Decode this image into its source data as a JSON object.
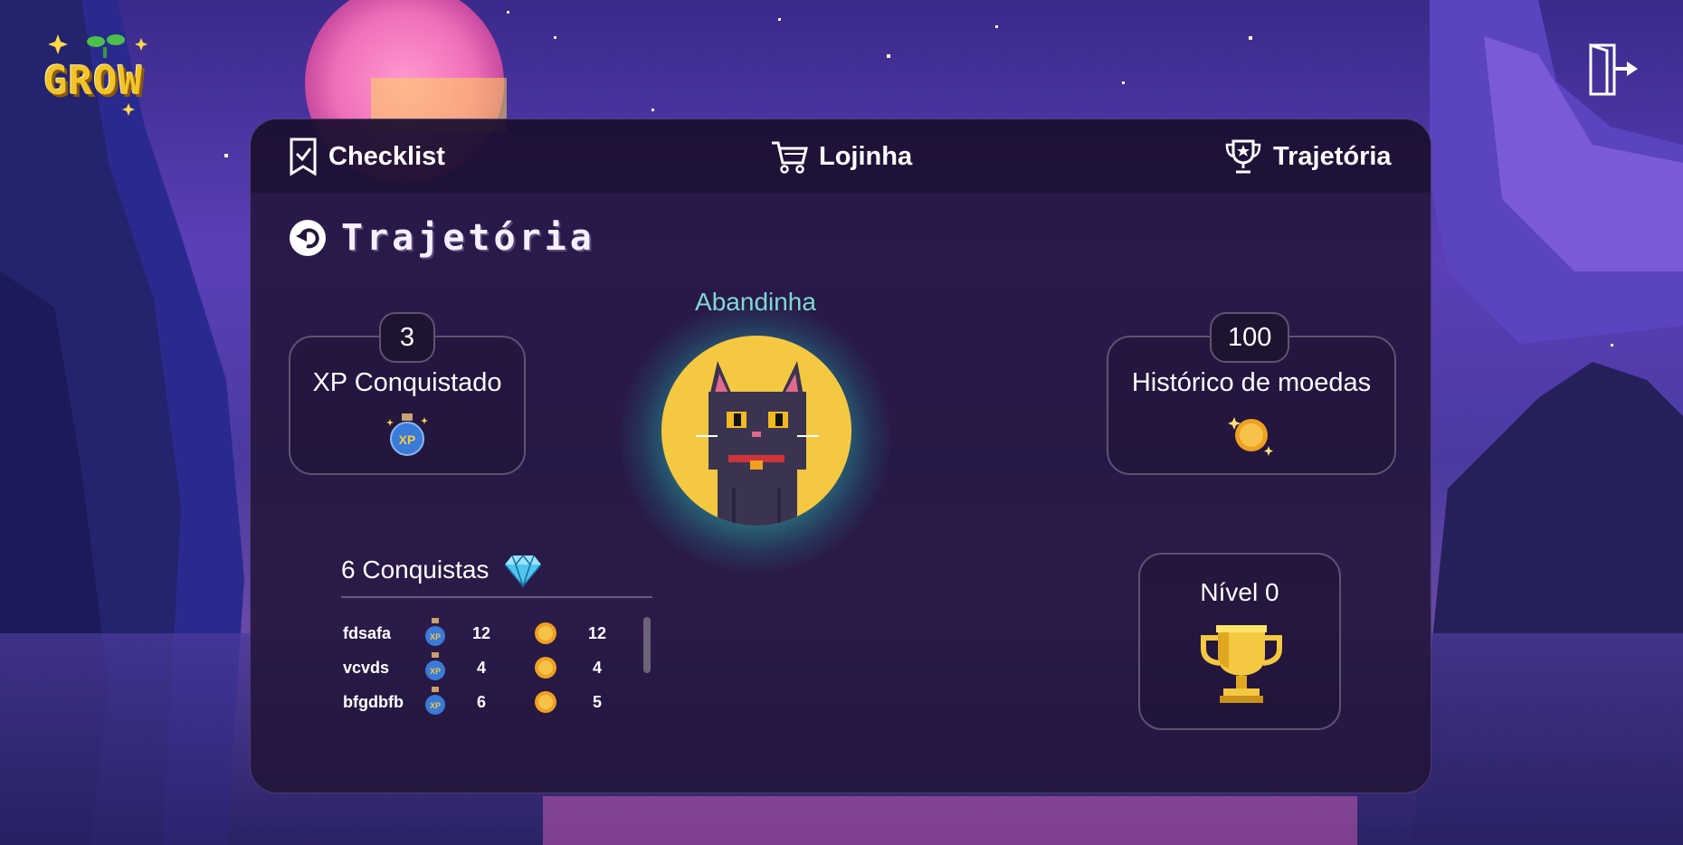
{
  "app": {
    "logo_text": "GROW"
  },
  "header": {
    "logout_icon": "logout-door-icon"
  },
  "nav": {
    "checklist": "Checklist",
    "lojinha": "Lojinha",
    "trajetoria": "Trajetória"
  },
  "page": {
    "title": "Trajetória"
  },
  "xp_card": {
    "value": "3",
    "label": "XP Conquistado",
    "icon": "xp-potion-icon"
  },
  "coins_card": {
    "value": "100",
    "label": "Histórico de moedas",
    "icon": "coin-icon"
  },
  "avatar": {
    "name": "Abandinha",
    "icon": "black-cat-avatar"
  },
  "achievements": {
    "title": "6 Conquistas",
    "icon": "diamond-icon",
    "rows": [
      {
        "name": "fdsafa",
        "xp": "12",
        "coins": "12"
      },
      {
        "name": "vcvds",
        "xp": "4",
        "coins": "4"
      },
      {
        "name": "bfgdbfb",
        "xp": "6",
        "coins": "5"
      }
    ]
  },
  "level_card": {
    "label": "Nível 0",
    "icon": "trophy-icon"
  },
  "colors": {
    "panel": "#221438",
    "accent_teal": "#7fd8d0",
    "gold": "#f5c842",
    "border": "#5e5470"
  }
}
